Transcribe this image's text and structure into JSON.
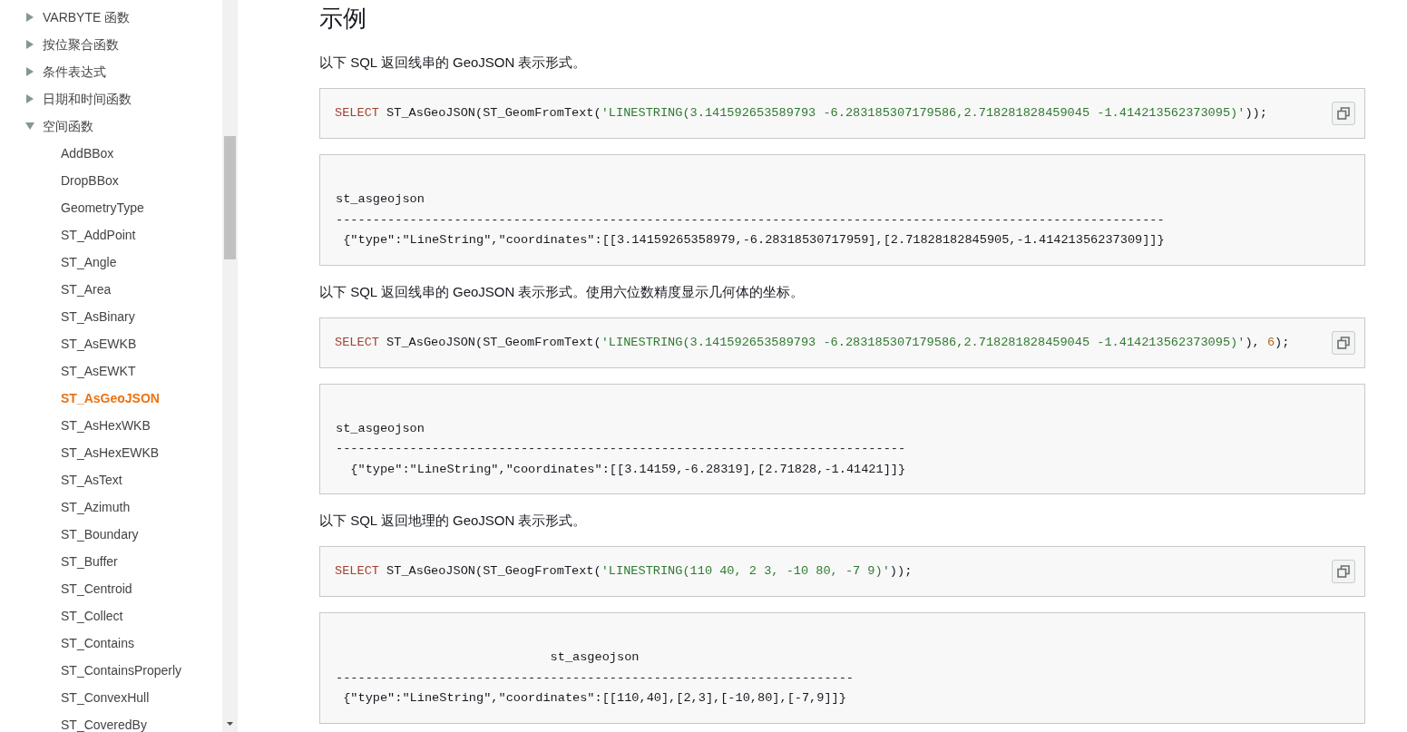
{
  "sidebar": {
    "items": [
      {
        "label": "VARBYTE 函数",
        "expanded": false,
        "selected": false
      },
      {
        "label": "按位聚合函数",
        "expanded": false,
        "selected": false
      },
      {
        "label": "条件表达式",
        "expanded": false,
        "selected": false
      },
      {
        "label": "日期和时间函数",
        "expanded": false,
        "selected": false
      },
      {
        "label": "空间函数",
        "expanded": true,
        "selected": false,
        "children": [
          {
            "label": "AddBBox",
            "selected": false
          },
          {
            "label": "DropBBox",
            "selected": false
          },
          {
            "label": "GeometryType",
            "selected": false
          },
          {
            "label": "ST_AddPoint",
            "selected": false
          },
          {
            "label": "ST_Angle",
            "selected": false
          },
          {
            "label": "ST_Area",
            "selected": false
          },
          {
            "label": "ST_AsBinary",
            "selected": false
          },
          {
            "label": "ST_AsEWKB",
            "selected": false
          },
          {
            "label": "ST_AsEWKT",
            "selected": false
          },
          {
            "label": "ST_AsGeoJSON",
            "selected": true
          },
          {
            "label": "ST_AsHexWKB",
            "selected": false
          },
          {
            "label": "ST_AsHexEWKB",
            "selected": false
          },
          {
            "label": "ST_AsText",
            "selected": false
          },
          {
            "label": "ST_Azimuth",
            "selected": false
          },
          {
            "label": "ST_Boundary",
            "selected": false
          },
          {
            "label": "ST_Buffer",
            "selected": false
          },
          {
            "label": "ST_Centroid",
            "selected": false
          },
          {
            "label": "ST_Collect",
            "selected": false
          },
          {
            "label": "ST_Contains",
            "selected": false
          },
          {
            "label": "ST_ContainsProperly",
            "selected": false
          },
          {
            "label": "ST_ConvexHull",
            "selected": false
          },
          {
            "label": "ST_CoveredBy",
            "selected": false
          }
        ]
      }
    ]
  },
  "content": {
    "heading": "示例",
    "examples": [
      {
        "description": "以下 SQL 返回线串的 GeoJSON 表示形式。",
        "code": [
          {
            "kind": "keyword",
            "text": "SELECT"
          },
          {
            "kind": "plain",
            "text": " ST_AsGeoJSON(ST_GeomFromText("
          },
          {
            "kind": "string",
            "text": "'LINESTRING(3.141592653589793 -6.283185307179586,2.718281828459045 -1.414213562373095)'"
          },
          {
            "kind": "plain",
            "text": "));"
          }
        ],
        "result": {
          "column": "st_asgeojson",
          "divider": "----------------------------------------------------------------------------------------------------------------",
          "row": " {\"type\":\"LineString\",\"coordinates\":[[3.14159265358979,-6.28318530717959],[2.71828182845905,-1.41421356237309]]}"
        }
      },
      {
        "description": "以下 SQL 返回线串的 GeoJSON 表示形式。使用六位数精度显示几何体的坐标。",
        "code": [
          {
            "kind": "keyword",
            "text": "SELECT"
          },
          {
            "kind": "plain",
            "text": " ST_AsGeoJSON(ST_GeomFromText("
          },
          {
            "kind": "string",
            "text": "'LINESTRING(3.141592653589793 -6.283185307179586,2.718281828459045 -1.414213562373095)'"
          },
          {
            "kind": "plain",
            "text": "), "
          },
          {
            "kind": "number",
            "text": "6"
          },
          {
            "kind": "plain",
            "text": ");"
          }
        ],
        "result": {
          "column": "st_asgeojson",
          "divider": "-----------------------------------------------------------------------------",
          "row": "  {\"type\":\"LineString\",\"coordinates\":[[3.14159,-6.28319],[2.71828,-1.41421]]}"
        }
      },
      {
        "description": "以下 SQL 返回地理的 GeoJSON 表示形式。",
        "code": [
          {
            "kind": "keyword",
            "text": "SELECT"
          },
          {
            "kind": "plain",
            "text": " ST_AsGeoJSON(ST_GeogFromText("
          },
          {
            "kind": "string",
            "text": "'LINESTRING(110 40, 2 3, -10 80, -7 9)'"
          },
          {
            "kind": "plain",
            "text": "));"
          }
        ],
        "result": {
          "column": "                             st_asgeojson",
          "divider": "----------------------------------------------------------------------",
          "row": " {\"type\":\"LineString\",\"coordinates\":[[110,40],[2,3],[-10,80],[-7,9]]}"
        }
      }
    ]
  }
}
